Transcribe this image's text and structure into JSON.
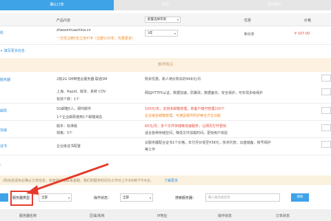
{
  "steps": [
    "确认订单",
    "支付",
    "支付成功"
  ],
  "order_table": {
    "headers": [
      "产品内容",
      "",
      "优惠",
      "价格"
    ],
    "select_placeholder": "配置选择年限",
    "row": {
      "name_short": "机",
      "domain": "zhaoxinhuachina.cn",
      "promo": "一次性注册5年立省¥78（注册5/10年，优惠更多）",
      "years": "3年",
      "discount": "新价折",
      "price": "¥ 107.00"
    },
    "change_link": "填写更多信息"
  },
  "recommend": {
    "title": "推荐购买",
    "items": [
      {
        "name": "服务器",
        "spec_lines": [
          "2核2G 5M带宽云服务器 联通3M",
          "上海、Rapid、版本、系统 CDV",
          "有效个数：1个"
        ],
        "desc_lines": [
          "购买优惠，新人特价购买的¥68元/月",
          "网站HTTPS认证，数据加速，防篡改，数据备份，安全保护，可实现多级保护"
        ]
      },
      {
        "name": "邮局",
        "spec_lines": [
          "5G邮箱5人，即时邮件",
          "1个企业邮局使用1个邮箱域名"
        ],
        "desc_lines": [
          "100元/年，支持多邮箱管理，单客户端可管理100个",
          "企业域名邮箱管理，可满足邮件防护等全方位功能"
        ]
      },
      {
        "name": "加速",
        "spec_lines": [
          "版本：标准版",
          "规格：5个"
        ],
        "desc_lines": [
          "60元/月，多个文件存储等加速服务，让网页打开更快",
          "适合各种存储空间，降低文件加载时间，更快用户体验"
        ]
      },
      {
        "name": "证书",
        "spec_lines": [
          "企业级证书配置"
        ],
        "desc_lines": [
          "云服务器配合证书1个价格，年付月价低至¥58元，技术托管，云盘储备，帐号保护",
          "等工作"
        ]
      }
    ]
  },
  "notice": {
    "text": "(购买前请务必确认订单信息，如有疑问请联系客服，我们的服务时间为工作日上午9点到下午6点。",
    "link": "了解更多"
  },
  "filter": {
    "type_label": "服务器类型：",
    "type_value": "全部",
    "status_label": "操作状态：",
    "status_value": "全部",
    "search_label": "搜索服务器：",
    "search_placeholder": "输入服务器名称",
    "search_button": "搜索"
  },
  "list_headers": [
    "服务器名称",
    "区域/系统",
    "IP地址",
    "操作状态",
    "订单状态"
  ],
  "colors": {
    "accent": "#3fa3e8",
    "annotation": "#e53a2b",
    "price": "#e34b3d"
  }
}
